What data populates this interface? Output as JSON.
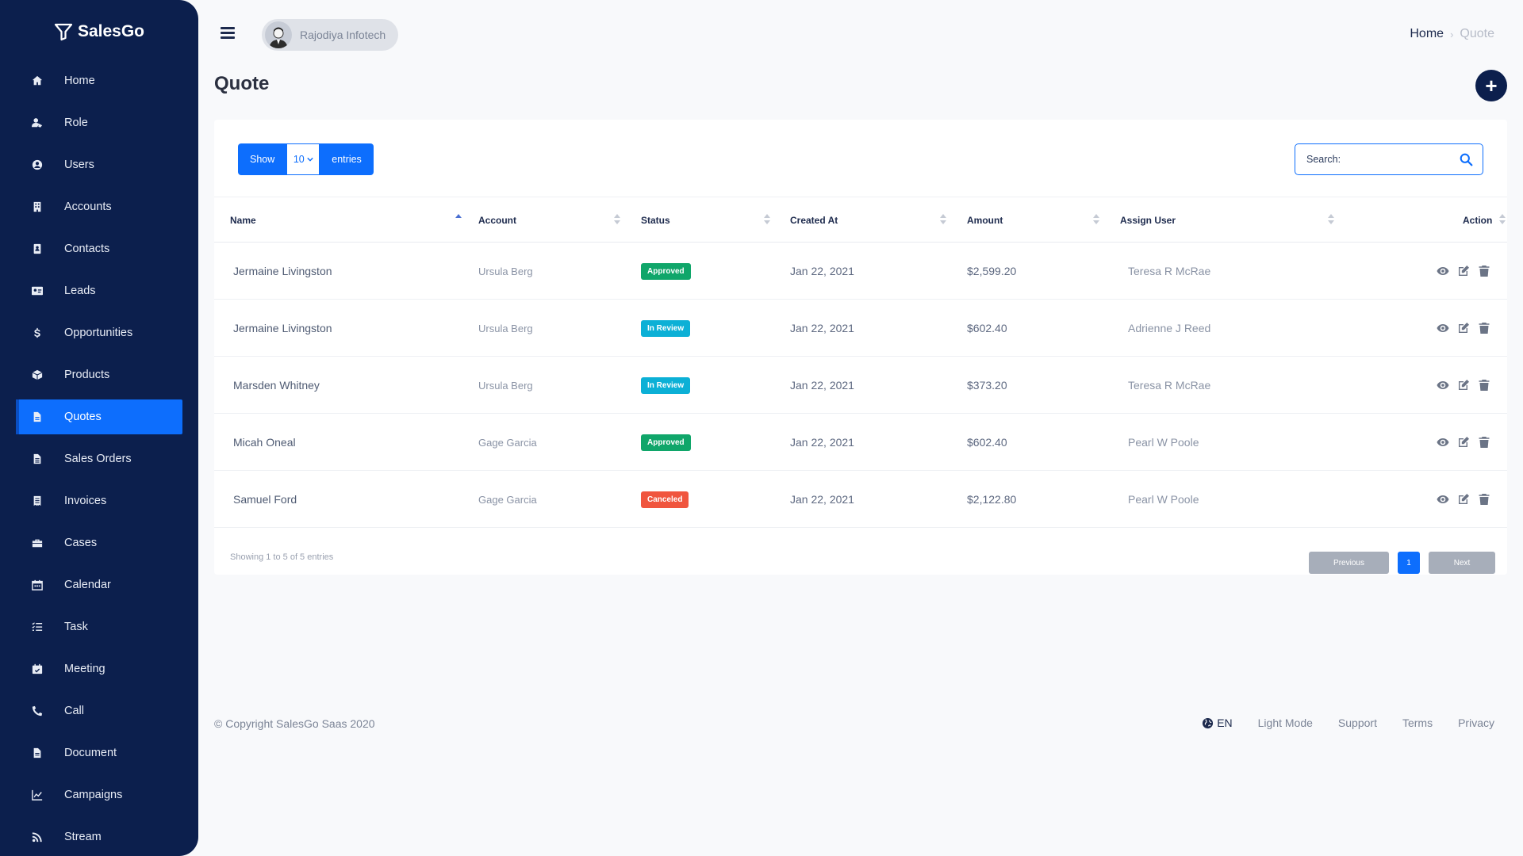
{
  "brand": {
    "name": "SalesGo"
  },
  "sidebar": {
    "items": [
      {
        "label": "Home",
        "icon": "home-icon"
      },
      {
        "label": "Role",
        "icon": "user-tag-icon"
      },
      {
        "label": "Users",
        "icon": "user-circle-icon"
      },
      {
        "label": "Accounts",
        "icon": "building-icon"
      },
      {
        "label": "Contacts",
        "icon": "address-book-icon"
      },
      {
        "label": "Leads",
        "icon": "id-card-icon"
      },
      {
        "label": "Opportunities",
        "icon": "dollar-icon"
      },
      {
        "label": "Products",
        "icon": "box-icon"
      },
      {
        "label": "Quotes",
        "icon": "file-invoice-icon",
        "active": true
      },
      {
        "label": "Sales Orders",
        "icon": "file-alt-icon"
      },
      {
        "label": "Invoices",
        "icon": "receipt-icon"
      },
      {
        "label": "Cases",
        "icon": "briefcase-icon"
      },
      {
        "label": "Calendar",
        "icon": "calendar-icon"
      },
      {
        "label": "Task",
        "icon": "tasks-icon"
      },
      {
        "label": "Meeting",
        "icon": "calendar-check-icon"
      },
      {
        "label": "Call",
        "icon": "phone-icon"
      },
      {
        "label": "Document",
        "icon": "file-icon"
      },
      {
        "label": "Campaigns",
        "icon": "chart-line-icon"
      },
      {
        "label": "Stream",
        "icon": "rss-icon"
      }
    ]
  },
  "header": {
    "user_name": "Rajodiya Infotech",
    "breadcrumb": {
      "home": "Home",
      "separator": "›",
      "current": "Quote"
    },
    "page_title": "Quote",
    "add_label": "+"
  },
  "table": {
    "show_label": "Show",
    "page_size": "10",
    "entries_label": "entries",
    "search_placeholder": "Search:",
    "columns": [
      "Name",
      "Account",
      "Status",
      "Created At",
      "Amount",
      "Assign User",
      "Action"
    ],
    "rows": [
      {
        "name": "Jermaine Livingston",
        "account": "Ursula Berg",
        "status": "Approved",
        "status_type": "approved",
        "created": "Jan 22, 2021",
        "amount": "$2,599.20",
        "user": "Teresa R McRae"
      },
      {
        "name": "Jermaine Livingston",
        "account": "Ursula Berg",
        "status": "In Review",
        "status_type": "review",
        "created": "Jan 22, 2021",
        "amount": "$602.40",
        "user": "Adrienne J Reed"
      },
      {
        "name": "Marsden Whitney",
        "account": "Ursula Berg",
        "status": "In Review",
        "status_type": "review",
        "created": "Jan 22, 2021",
        "amount": "$373.20",
        "user": "Teresa R McRae"
      },
      {
        "name": "Micah Oneal",
        "account": "Gage Garcia",
        "status": "Approved",
        "status_type": "approved",
        "created": "Jan 22, 2021",
        "amount": "$602.40",
        "user": "Pearl W Poole"
      },
      {
        "name": "Samuel Ford",
        "account": "Gage Garcia",
        "status": "Canceled",
        "status_type": "canceled",
        "created": "Jan 22, 2021",
        "amount": "$2,122.80",
        "user": "Pearl W Poole"
      }
    ],
    "info": "Showing 1 to 5 of 5 entries",
    "pagination": {
      "previous": "Previous",
      "current": "1",
      "next": "Next"
    }
  },
  "footer": {
    "copyright": "© Copyright SalesGo Saas 2020",
    "lang": "EN",
    "links": [
      "Light Mode",
      "Support",
      "Terms",
      "Privacy"
    ]
  },
  "colors": {
    "sidebar": "#0c1f4d",
    "accent": "#0d6efd",
    "approved": "#10a66a",
    "review": "#0cb0d6",
    "canceled": "#f0553e"
  }
}
